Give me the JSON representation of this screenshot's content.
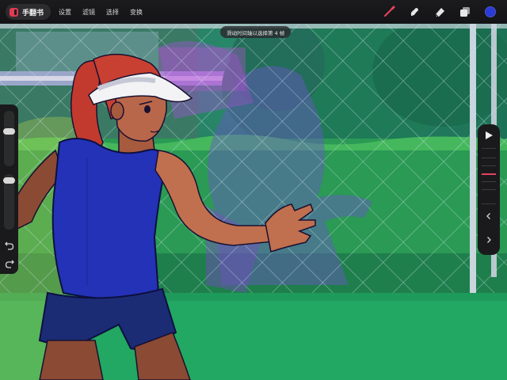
{
  "app": {
    "name": "手翻书",
    "accent_color": "#e23a52"
  },
  "menu": [
    {
      "label": "设置"
    },
    {
      "label": "滤镜"
    },
    {
      "label": "选择"
    },
    {
      "label": "变换"
    }
  ],
  "tools": [
    {
      "name": "brush-icon",
      "active": true,
      "color": "#e8425f"
    },
    {
      "name": "smudge-icon",
      "active": false,
      "color": "#e6e6e6"
    },
    {
      "name": "eraser-icon",
      "active": false,
      "color": "#e6e6e6"
    },
    {
      "name": "layers-icon",
      "active": false,
      "color": "#e6e6e6"
    }
  ],
  "current_color": "#2a3ad6",
  "toast": {
    "text": "滑动时间轴以选择第 4 帧"
  },
  "left_sidebar": {
    "brush_size_level": 0.35,
    "opacity_level": 0.7,
    "undo_icon": "undo-icon",
    "redo_icon": "redo-icon"
  },
  "right_sidebar": {
    "play_icon": "play-icon",
    "prev_icon": "chevron-left-icon",
    "next_icon": "chevron-right-icon",
    "frame_marker_color": "#e8425f"
  }
}
